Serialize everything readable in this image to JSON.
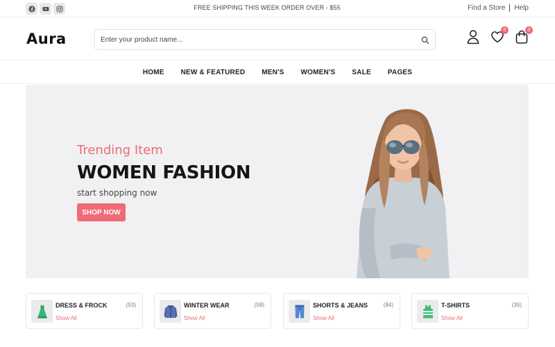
{
  "topbar": {
    "social": [
      "facebook-icon",
      "youtube-icon",
      "instagram-icon"
    ],
    "notice": "FREE SHIPPING THIS WEEK ORDER OVER - $55",
    "links": [
      "Find a Store",
      "Help"
    ]
  },
  "header": {
    "logo": "Aura",
    "search_placeholder": "Enter your product name...",
    "wishlist_count": "0",
    "cart_count": "0"
  },
  "nav": {
    "items": [
      "HOME",
      "NEW & FEATURED",
      "MEN'S",
      "WOMEN'S",
      "SALE",
      "PAGES"
    ]
  },
  "hero": {
    "subtitle": "Trending Item",
    "title": "WOMEN FASHION",
    "text": "start shopping now",
    "button": "SHOP NOW"
  },
  "categories": [
    {
      "name": "DRESS & FROCK",
      "count": "(53)",
      "link": "Show All",
      "icon": "dress-icon"
    },
    {
      "name": "WINTER WEAR",
      "count": "(58)",
      "link": "Show All",
      "icon": "jacket-icon"
    },
    {
      "name": "SHORTS & JEANS",
      "count": "(84)",
      "link": "Show All",
      "icon": "jeans-icon"
    },
    {
      "name": "T-SHIRTS",
      "count": "(35)",
      "link": "Show All",
      "icon": "tank-top-icon"
    }
  ],
  "colors": {
    "accent": "#ef6b77",
    "hero_bg": "#f1f1f3",
    "text_dark": "#151515"
  }
}
